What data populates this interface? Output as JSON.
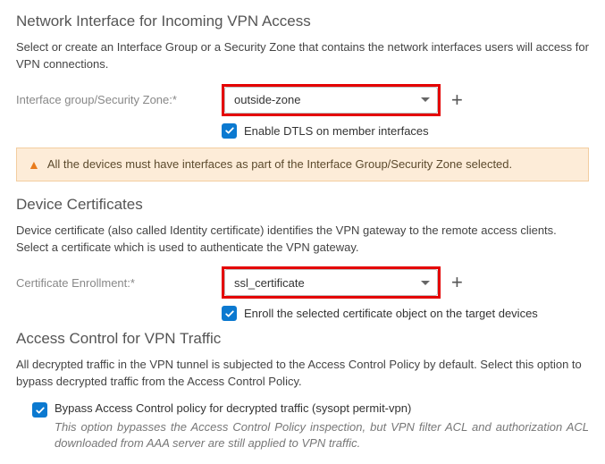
{
  "networkInterface": {
    "heading": "Network Interface for Incoming VPN Access",
    "desc": "Select or create an Interface Group or a Security Zone that contains the network interfaces users will access for VPN connections.",
    "label": "Interface group/Security Zone:*",
    "value": "outside-zone",
    "dtlsLabel": "Enable DTLS on member interfaces",
    "alert": "All the devices must have interfaces as part of the Interface Group/Security Zone selected."
  },
  "deviceCertificates": {
    "heading": "Device Certificates",
    "desc": "Device certificate (also called Identity certificate) identifies the VPN gateway to the remote access clients. Select a certificate which is used to authenticate the VPN gateway.",
    "label": "Certificate Enrollment:*",
    "value": "ssl_certificate",
    "enrollLabel": "Enroll the selected certificate object on the target devices"
  },
  "accessControl": {
    "heading": "Access Control for VPN Traffic",
    "desc": "All decrypted traffic in the VPN tunnel is subjected to the Access Control Policy by default. Select this option to bypass decrypted traffic from the Access Control Policy.",
    "bypassLabel": "Bypass Access Control policy for decrypted traffic (sysopt permit-vpn)",
    "bypassNote": "This option bypasses the Access Control Policy inspection, but VPN filter ACL and authorization ACL downloaded from AAA server are still applied to VPN traffic."
  }
}
